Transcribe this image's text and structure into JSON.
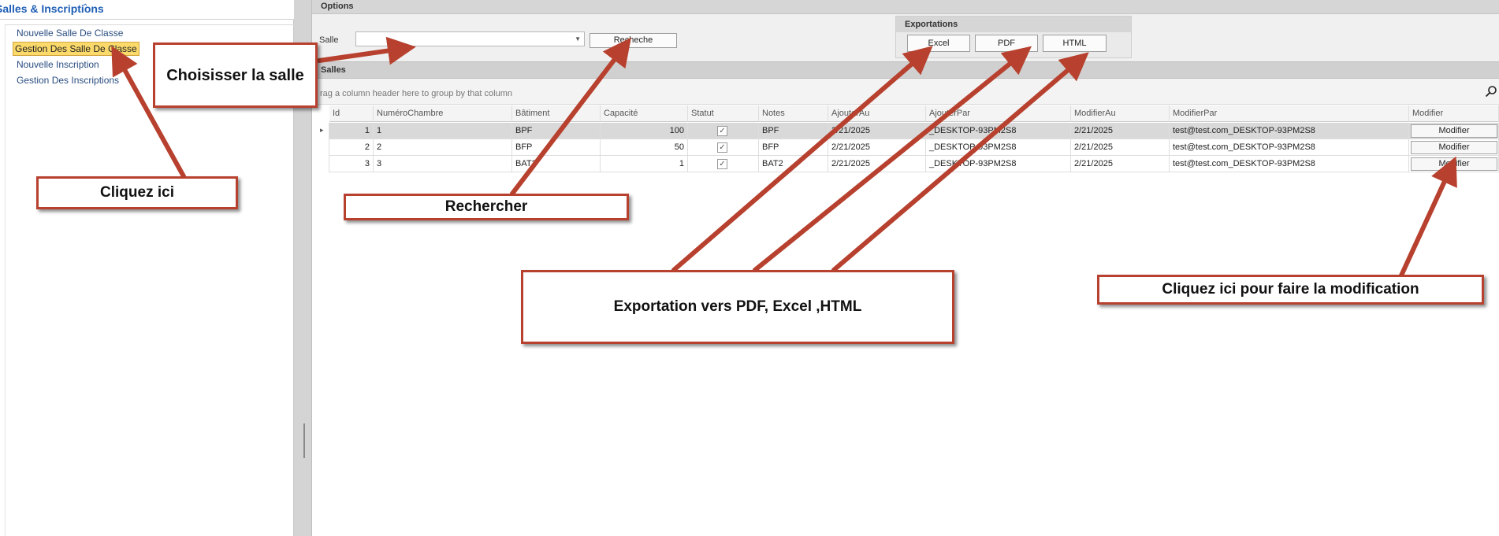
{
  "sidebar": {
    "title": "Salles & Inscriptions",
    "items": [
      {
        "label": "Nouvelle Salle De Classe"
      },
      {
        "label": "Gestion Des Salle De Classe"
      },
      {
        "label": "Nouvelle Inscription"
      },
      {
        "label": "Gestion Des Inscriptions"
      }
    ]
  },
  "options": {
    "title": "Options",
    "salle_label": "Salle",
    "salle_value": "",
    "search_button": "Recheche"
  },
  "exports": {
    "title": "Exportations",
    "excel": "Excel",
    "pdf": "PDF",
    "html": "HTML"
  },
  "salles": {
    "title": "Salles",
    "group_hint": "rag a column header here to group by that column",
    "columns": [
      "Id",
      "NuméroChambre",
      "Bâtiment",
      "Capacité",
      "Statut",
      "Notes",
      "AjouterAu",
      "AjouterPar",
      "ModifierAu",
      "ModifierPar",
      "Modifier"
    ],
    "rows": [
      {
        "id": "1",
        "numero": "1",
        "batiment": "BPF",
        "capacite": "100",
        "statut": true,
        "notes": "BPF",
        "ajouter_au": "2/21/2025",
        "ajouter_par": "_DESKTOP-93PM2S8",
        "modifier_au": "2/21/2025",
        "modifier_par": "test@test.com_DESKTOP-93PM2S8",
        "action": "Modifier"
      },
      {
        "id": "2",
        "numero": "2",
        "batiment": "BFP",
        "capacite": "50",
        "statut": true,
        "notes": "BFP",
        "ajouter_au": "2/21/2025",
        "ajouter_par": "_DESKTOP-93PM2S8",
        "modifier_au": "2/21/2025",
        "modifier_par": "test@test.com_DESKTOP-93PM2S8",
        "action": "Modifier"
      },
      {
        "id": "3",
        "numero": "3",
        "batiment": "BAT2",
        "capacite": "1",
        "statut": true,
        "notes": "BAT2",
        "ajouter_au": "2/21/2025",
        "ajouter_par": "_DESKTOP-93PM2S8",
        "modifier_au": "2/21/2025",
        "modifier_par": "test@test.com_DESKTOP-93PM2S8",
        "action": "Modifier"
      }
    ]
  },
  "annotations": {
    "choisir_salle": "Choisisser la salle",
    "cliquez_ici": "Cliquez ici",
    "rechercher": "Rechercher",
    "exportation": "Exportation vers PDF, Excel ,HTML",
    "modification": "Cliquez ici pour faire la modification"
  },
  "colors": {
    "accent_blue": "#1f5fb5",
    "selection_yellow": "#fbd96a",
    "annotation_red": "#b7412e"
  }
}
